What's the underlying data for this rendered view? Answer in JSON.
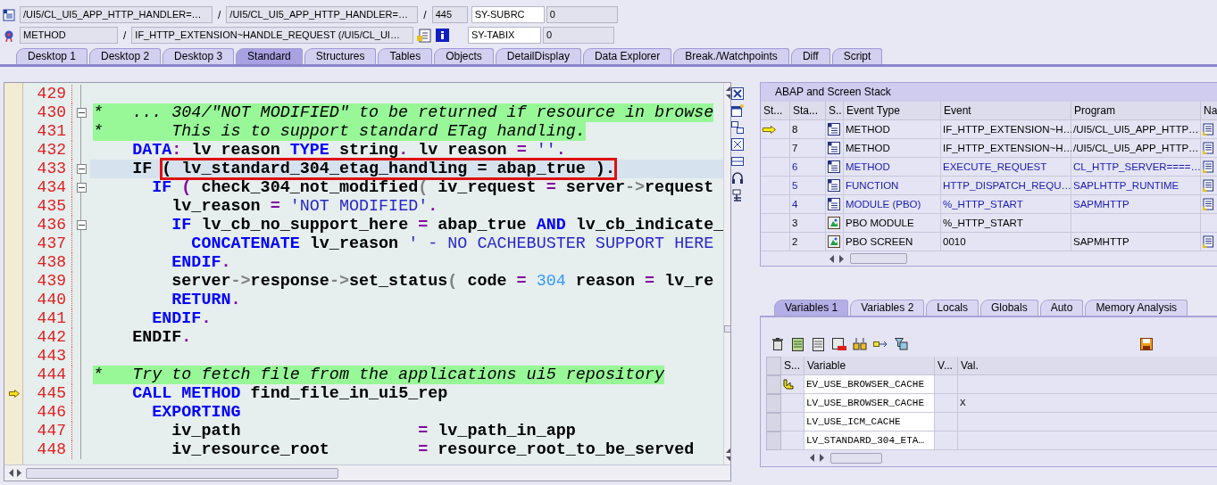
{
  "header": {
    "rows": [
      {
        "items": [
          {
            "kind": "icon"
          },
          {
            "kind": "field",
            "text": "/UI5/CL_UI5_APP_HTTP_HANDLER=…"
          },
          {
            "kind": "sep",
            "text": "/"
          },
          {
            "kind": "field",
            "text": "/UI5/CL_UI5_APP_HTTP_HANDLER=…"
          },
          {
            "kind": "sep",
            "text": "/"
          },
          {
            "kind": "field",
            "text": "445"
          }
        ],
        "system": [
          {
            "text": "SY-SUBRC",
            "editable": true
          },
          {
            "text": "0",
            "editable": false
          }
        ]
      },
      {
        "items": [
          {
            "kind": "icon"
          },
          {
            "kind": "field",
            "text": "METHOD"
          },
          {
            "kind": "sep",
            "text": "/"
          },
          {
            "kind": "field",
            "text": "IF_HTTP_EXTENSION~HANDLE_REQUEST (/UI5/CL_UI…"
          },
          {
            "kind": "icon"
          },
          {
            "kind": "icon"
          }
        ],
        "system": [
          {
            "text": "SY-TABIX",
            "editable": true
          },
          {
            "text": "0",
            "editable": false
          }
        ]
      }
    ]
  },
  "tabs": [
    {
      "label": "Desktop 1",
      "selected": false
    },
    {
      "label": "Desktop 2",
      "selected": false
    },
    {
      "label": "Desktop 3",
      "selected": false
    },
    {
      "label": "Standard",
      "selected": true
    },
    {
      "label": "Structures",
      "selected": false
    },
    {
      "label": "Tables",
      "selected": false
    },
    {
      "label": "Objects",
      "selected": false
    },
    {
      "label": "DetailDisplay",
      "selected": false
    },
    {
      "label": "Data Explorer",
      "selected": false
    },
    {
      "label": "Break./Watchpoints",
      "selected": false
    },
    {
      "label": "Diff",
      "selected": false
    },
    {
      "label": "Script",
      "selected": false
    }
  ],
  "editor": {
    "lines": [
      {
        "number": "429",
        "foldable": false,
        "current": false,
        "execution_point": false
      },
      {
        "number": "430",
        "foldable": true,
        "current": false,
        "execution_point": false,
        "segments": [
          {
            "kind": "comment",
            "text": "*   ... 304/\"NOT MODIFIED\" to be returned if resource in browse"
          }
        ]
      },
      {
        "number": "431",
        "foldable": false,
        "current": false,
        "execution_point": false,
        "segments": [
          {
            "kind": "comment",
            "text": "*       This is to support standard ETag handling."
          }
        ]
      },
      {
        "number": "432",
        "foldable": false,
        "current": false,
        "execution_point": false,
        "segments": [
          {
            "kind": "keyword",
            "text": "    DATA"
          },
          {
            "kind": "operator",
            "text": ":"
          },
          {
            "kind": "ident",
            "text": " lv reason "
          },
          {
            "kind": "keyword",
            "text": "TYPE"
          },
          {
            "kind": "ident",
            "text": " string"
          },
          {
            "kind": "operator",
            "text": "."
          },
          {
            "kind": "ident",
            "text": " lv reason "
          },
          {
            "kind": "operator",
            "text": "="
          },
          {
            "kind": "string",
            "text": " ''"
          },
          {
            "kind": "operator",
            "text": "."
          }
        ]
      },
      {
        "number": "433",
        "foldable": true,
        "current": true,
        "execution_point": false,
        "segments": [
          {
            "kind": "ident",
            "text": "    IF "
          },
          {
            "kind": "ident",
            "text": "( lv_standard_304_etag_handling = abap_true ).",
            "boxed": true
          }
        ]
      },
      {
        "number": "434",
        "foldable": true,
        "current": false,
        "execution_point": false,
        "segments": [
          {
            "kind": "keyword",
            "text": "      IF"
          },
          {
            "kind": "operator",
            "text": " ( "
          },
          {
            "kind": "ident",
            "text": "check_304_not_modified"
          },
          {
            "kind": "punct",
            "text": "("
          },
          {
            "kind": "ident",
            "text": " iv_request "
          },
          {
            "kind": "operator",
            "text": "="
          },
          {
            "kind": "ident",
            "text": " server"
          },
          {
            "kind": "punct",
            "text": "->"
          },
          {
            "kind": "ident",
            "text": "request"
          }
        ]
      },
      {
        "number": "435",
        "foldable": false,
        "current": false,
        "execution_point": false,
        "segments": [
          {
            "kind": "ident",
            "text": "        lv_reason "
          },
          {
            "kind": "operator",
            "text": "="
          },
          {
            "kind": "string",
            "text": " 'NOT MODIFIED'"
          },
          {
            "kind": "operator",
            "text": "."
          }
        ]
      },
      {
        "number": "436",
        "foldable": true,
        "current": false,
        "execution_point": false,
        "segments": [
          {
            "kind": "keyword",
            "text": "        IF"
          },
          {
            "kind": "ident",
            "text": " lv_cb_no_support_here "
          },
          {
            "kind": "operator",
            "text": "="
          },
          {
            "kind": "ident",
            "text": " abap_true "
          },
          {
            "kind": "keyword",
            "text": "AND"
          },
          {
            "kind": "ident",
            "text": " lv_cb_indicate_"
          }
        ]
      },
      {
        "number": "437",
        "foldable": false,
        "current": false,
        "execution_point": false,
        "segments": [
          {
            "kind": "keyword",
            "text": "          CONCATENATE"
          },
          {
            "kind": "ident",
            "text": " lv_reason "
          },
          {
            "kind": "string",
            "text": "' - NO CACHEBUSTER SUPPORT HERE"
          }
        ]
      },
      {
        "number": "438",
        "foldable": false,
        "current": false,
        "execution_point": false,
        "segments": [
          {
            "kind": "keyword",
            "text": "        ENDIF"
          },
          {
            "kind": "operator",
            "text": "."
          }
        ]
      },
      {
        "number": "439",
        "foldable": false,
        "current": false,
        "execution_point": false,
        "segments": [
          {
            "kind": "ident",
            "text": "        server"
          },
          {
            "kind": "punct",
            "text": "->"
          },
          {
            "kind": "ident",
            "text": "response"
          },
          {
            "kind": "punct",
            "text": "->"
          },
          {
            "kind": "ident",
            "text": "set_status"
          },
          {
            "kind": "punct",
            "text": "("
          },
          {
            "kind": "ident",
            "text": " code "
          },
          {
            "kind": "operator",
            "text": "="
          },
          {
            "kind": "number",
            "text": " 304"
          },
          {
            "kind": "ident",
            "text": " reason "
          },
          {
            "kind": "operator",
            "text": "="
          },
          {
            "kind": "ident",
            "text": " lv_re"
          }
        ]
      },
      {
        "number": "440",
        "foldable": false,
        "current": false,
        "execution_point": false,
        "segments": [
          {
            "kind": "keyword",
            "text": "        RETURN"
          },
          {
            "kind": "operator",
            "text": "."
          }
        ]
      },
      {
        "number": "441",
        "foldable": false,
        "current": false,
        "execution_point": false,
        "segments": [
          {
            "kind": "keyword",
            "text": "      ENDIF"
          },
          {
            "kind": "operator",
            "text": "."
          }
        ]
      },
      {
        "number": "442",
        "foldable": false,
        "current": false,
        "execution_point": false,
        "segments": [
          {
            "kind": "ident",
            "text": "    ENDIF"
          },
          {
            "kind": "operator",
            "text": "."
          }
        ]
      },
      {
        "number": "443",
        "foldable": false,
        "current": false,
        "execution_point": false
      },
      {
        "number": "444",
        "foldable": false,
        "current": false,
        "execution_point": false,
        "segments": [
          {
            "kind": "comment",
            "text": "*   Try to fetch file from the applications ui5 repository"
          }
        ]
      },
      {
        "number": "445",
        "foldable": false,
        "current": false,
        "execution_point": true,
        "segments": [
          {
            "kind": "keyword",
            "text": "    CALL METHOD"
          },
          {
            "kind": "ident",
            "text": " find_file_in_ui5_rep"
          }
        ]
      },
      {
        "number": "446",
        "foldable": false,
        "current": false,
        "execution_point": false,
        "segments": [
          {
            "kind": "keyword",
            "text": "      EXPORTING"
          }
        ]
      },
      {
        "number": "447",
        "foldable": false,
        "current": false,
        "execution_point": false,
        "segments": [
          {
            "kind": "ident",
            "text": "        iv_path                  "
          },
          {
            "kind": "operator",
            "text": "="
          },
          {
            "kind": "ident",
            "text": " lv_path_in_app"
          }
        ]
      },
      {
        "number": "448",
        "foldable": false,
        "current": false,
        "execution_point": false,
        "segments": [
          {
            "kind": "ident",
            "text": "        iv_resource_root         "
          },
          {
            "kind": "operator",
            "text": "="
          },
          {
            "kind": "ident",
            "text": " resource_root_to_be_served"
          }
        ]
      }
    ]
  },
  "stack": {
    "title": "ABAP and Screen Stack",
    "columns": [
      "St...",
      "Sta...",
      "S..",
      "Event Type",
      "Event",
      "Program",
      "Na"
    ],
    "rows": [
      {
        "current": true,
        "level": "8",
        "kind": "code",
        "event_type": "METHOD",
        "event": "IF_HTTP_EXTENSION~H…",
        "program": "/UI5/CL_UI5_APP_HTTP…",
        "nav": true,
        "external": false
      },
      {
        "current": false,
        "level": "7",
        "kind": "code",
        "event_type": "METHOD",
        "event": "IF_HTTP_EXTENSION~H…",
        "program": "/UI5/CL_UI5_APP_HTTP…",
        "nav": true,
        "external": false
      },
      {
        "current": false,
        "level": "6",
        "kind": "code",
        "event_type": "METHOD",
        "event": "EXECUTE_REQUEST",
        "program": "CL_HTTP_SERVER====…",
        "nav": true,
        "external": true
      },
      {
        "current": false,
        "level": "5",
        "kind": "code",
        "event_type": "FUNCTION",
        "event": "HTTP_DISPATCH_REQU…",
        "program": "SAPLHTTP_RUNTIME",
        "nav": true,
        "external": true
      },
      {
        "current": false,
        "level": "4",
        "kind": "code",
        "event_type": "MODULE (PBO)",
        "event": "%_HTTP_START",
        "program": "SAPMHTTP",
        "nav": true,
        "external": true
      },
      {
        "current": false,
        "level": "3",
        "kind": "screen",
        "event_type": "PBO MODULE",
        "event": "%_HTTP_START",
        "nav": false,
        "external": false
      },
      {
        "current": false,
        "level": "2",
        "kind": "screen",
        "event_type": "PBO SCREEN",
        "event": "0010",
        "program": "SAPMHTTP",
        "nav": true,
        "external": false
      }
    ]
  },
  "variable_tabs": [
    {
      "label": "Variables 1",
      "selected": true
    },
    {
      "label": "Variables 2",
      "selected": false
    },
    {
      "label": "Locals",
      "selected": false
    },
    {
      "label": "Globals",
      "selected": false
    },
    {
      "label": "Auto",
      "selected": false
    },
    {
      "label": "Memory Analysis",
      "selected": false
    }
  ],
  "variables": {
    "columns": [
      "S...",
      "Variable",
      "V...",
      "Val."
    ],
    "rows": [
      {
        "exporting": true,
        "name": "EV_USE_BROWSER_CACHE"
      },
      {
        "exporting": false,
        "name": "LV_USE_BROWSER_CACHE",
        "value": "X"
      },
      {
        "exporting": false,
        "name": "LV_USE_ICM_CACHE"
      },
      {
        "exporting": false,
        "name": "LV_STANDARD_304_ETA…"
      }
    ]
  }
}
